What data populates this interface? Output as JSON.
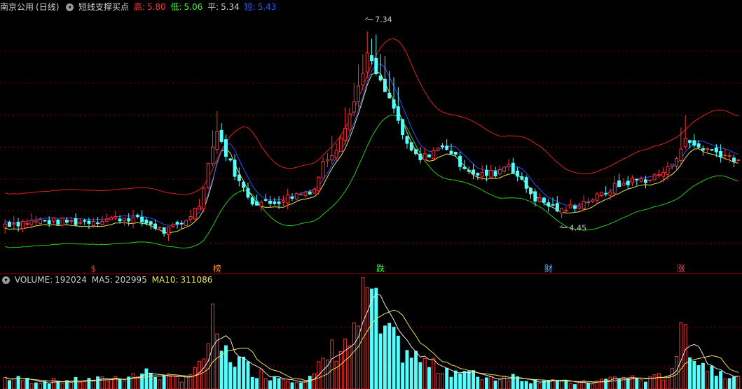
{
  "header": {
    "stock": "南京公用",
    "period": "(日线)",
    "indicator": "短线支撑买点",
    "high_label": "高:",
    "high_value": "5.80",
    "low_label": "低:",
    "low_value": "5.06",
    "avg_label": "平:",
    "avg_value": "5.34",
    "short_label": "短:",
    "short_value": "5.43"
  },
  "volume_header": {
    "label": "VOLUME:",
    "value": "192024",
    "ma5_label": "MA5:",
    "ma5_value": "202995",
    "ma10_label": "MA10:",
    "ma10_value": "311086"
  },
  "colors": {
    "up": "#ff3232",
    "down": "#54ffff",
    "high_band": "#e02020",
    "low_band": "#22cc22",
    "short_line": "#e6e65a",
    "mid_line": "#3050ff",
    "grid": "#7a0000",
    "ma5": "#e8e8e8",
    "ma10": "#e6e65a"
  },
  "chart_data": {
    "type": "candlestick",
    "price_range": [
      3.7,
      7.6
    ],
    "grid_levels": [
      4.0,
      4.5,
      5.0,
      5.5,
      6.0,
      6.5,
      7.0
    ],
    "peak_annotation": {
      "index": 82,
      "value": "7.34"
    },
    "trough_annotation": {
      "index": 126,
      "value": "4.45"
    },
    "events": [
      {
        "index": 20,
        "label": "$",
        "color": "#ff3232"
      },
      {
        "index": 48,
        "label": "榜",
        "color": "#ff8c3c"
      },
      {
        "index": 85,
        "label": "跌",
        "color": "#3cff3c"
      },
      {
        "index": 123,
        "label": "财",
        "color": "#54b8ff"
      },
      {
        "index": 153,
        "label": "涨",
        "color": "#ff4060"
      }
    ],
    "volume_range": [
      0,
      560000
    ],
    "anchors": [
      [
        0,
        4.3,
        60000
      ],
      [
        8,
        4.35,
        40000
      ],
      [
        16,
        4.33,
        45000
      ],
      [
        22,
        4.37,
        50000
      ],
      [
        28,
        4.4,
        70000
      ],
      [
        33,
        4.3,
        90000
      ],
      [
        36,
        4.18,
        60000
      ],
      [
        40,
        4.3,
        60000
      ],
      [
        44,
        4.6,
        110000
      ],
      [
        47,
        5.55,
        330000
      ],
      [
        48,
        5.75,
        230000
      ],
      [
        50,
        5.4,
        190000
      ],
      [
        53,
        4.95,
        150000
      ],
      [
        56,
        4.65,
        100000
      ],
      [
        60,
        4.62,
        70000
      ],
      [
        64,
        4.72,
        60000
      ],
      [
        68,
        4.8,
        45000
      ],
      [
        70,
        4.85,
        70000
      ],
      [
        72,
        5.25,
        150000
      ],
      [
        75,
        5.5,
        230000
      ],
      [
        79,
        6.2,
        270000
      ],
      [
        82,
        6.95,
        550000
      ],
      [
        85,
        6.5,
        320000
      ],
      [
        88,
        6.1,
        240000
      ],
      [
        91,
        5.5,
        200000
      ],
      [
        94,
        5.3,
        150000
      ],
      [
        97,
        5.45,
        120000
      ],
      [
        100,
        5.5,
        110000
      ],
      [
        103,
        5.25,
        90000
      ],
      [
        107,
        5.05,
        70000
      ],
      [
        111,
        5.1,
        60000
      ],
      [
        114,
        5.25,
        70000
      ],
      [
        117,
        4.95,
        60000
      ],
      [
        120,
        4.7,
        40000
      ],
      [
        123,
        4.6,
        60000
      ],
      [
        126,
        4.5,
        35000
      ],
      [
        130,
        4.62,
        30000
      ],
      [
        134,
        4.72,
        40000
      ],
      [
        138,
        4.88,
        60000
      ],
      [
        142,
        4.98,
        60000
      ],
      [
        146,
        5.0,
        50000
      ],
      [
        150,
        5.15,
        80000
      ],
      [
        154,
        5.6,
        320000
      ],
      [
        157,
        5.5,
        150000
      ],
      [
        160,
        5.45,
        110000
      ],
      [
        163,
        5.38,
        90000
      ],
      [
        166,
        5.3,
        70000
      ]
    ]
  }
}
